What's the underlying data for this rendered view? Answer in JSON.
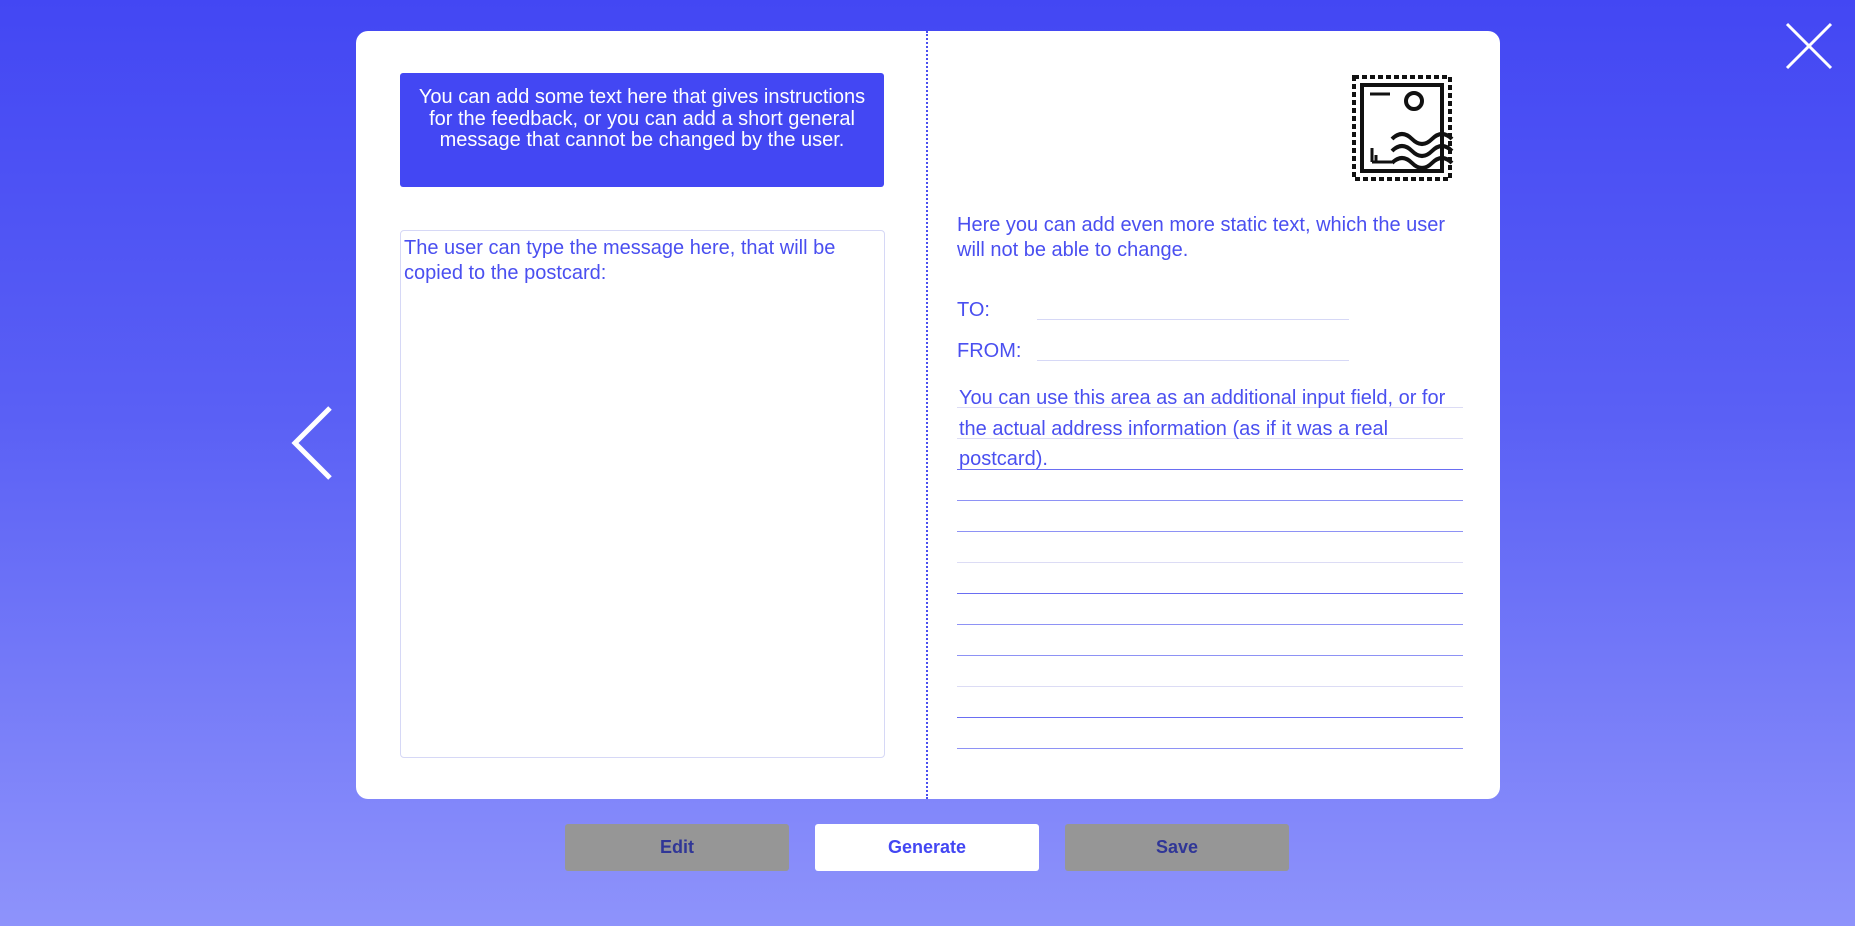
{
  "card": {
    "instructions": "You can add some text here that gives instructions for the feedback, or you can add a short general message that cannot be changed by the user.",
    "message_value": "The user can type the message here, that will be copied to the postcard:",
    "static_text": "Here you can add even more static text, which the user will not be able to change.",
    "to_label": "TO:",
    "from_label": "FROM:",
    "to_value": "",
    "from_value": "",
    "address_area_value": "You can use this area as an additional input field, or for the actual address information (as if it was a real postcard)."
  },
  "buttons": {
    "edit": "Edit",
    "generate": "Generate",
    "save": "Save"
  },
  "icons": {
    "close": "close-icon",
    "previous": "chevron-left-icon",
    "stamp": "postage-stamp-icon"
  },
  "colors": {
    "accent": "#4347f3",
    "text_accent": "#4a4ff0",
    "button_gray": "#969696",
    "button_dark_text": "#303697"
  }
}
